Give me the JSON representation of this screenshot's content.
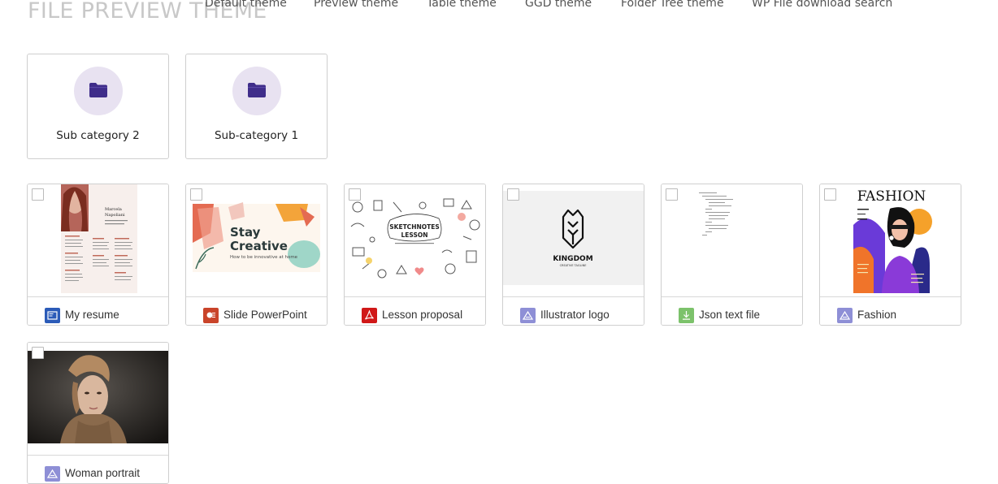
{
  "header": {
    "title": "FILE PREVIEW THEME",
    "nav": [
      "Default theme",
      "Preview theme",
      "Table theme",
      "GGD theme",
      "Folder Tree theme",
      "WP File download search"
    ]
  },
  "folders": [
    {
      "name": "Sub category 2",
      "icon": "folder-icon"
    },
    {
      "name": "Sub-category 1",
      "icon": "folder-icon"
    }
  ],
  "resume": {
    "person_first": "Marcela",
    "person_last": "Napoliani"
  },
  "slide": {
    "title_line1": "Stay",
    "title_line2": "Creative",
    "subtitle": "How to be innovative at home"
  },
  "lesson": {
    "title_line1": "SKETCHNOTES",
    "title_line2": "LESSON"
  },
  "logo": {
    "brand": "KINGDOM",
    "tagline": "CREATIVE TAGLINE"
  },
  "fashion": {
    "heading": "FASHION"
  },
  "files": [
    {
      "name": "My resume",
      "type": "word",
      "icon": "word-file-icon"
    },
    {
      "name": "Slide PowerPoint",
      "type": "ppt",
      "icon": "powerpoint-file-icon"
    },
    {
      "name": "Lesson proposal",
      "type": "pdf",
      "icon": "pdf-file-icon"
    },
    {
      "name": "Illustrator logo",
      "type": "image",
      "icon": "image-file-icon"
    },
    {
      "name": "Json text file",
      "type": "json",
      "icon": "download-file-icon"
    },
    {
      "name": "Fashion",
      "type": "image",
      "icon": "image-file-icon"
    },
    {
      "name": "Woman portrait",
      "type": "image",
      "icon": "image-file-icon"
    }
  ],
  "colors": {
    "folder_icon": "#3f2d8a",
    "folder_bg": "#e8e2f1",
    "border": "#cfcfcf"
  }
}
